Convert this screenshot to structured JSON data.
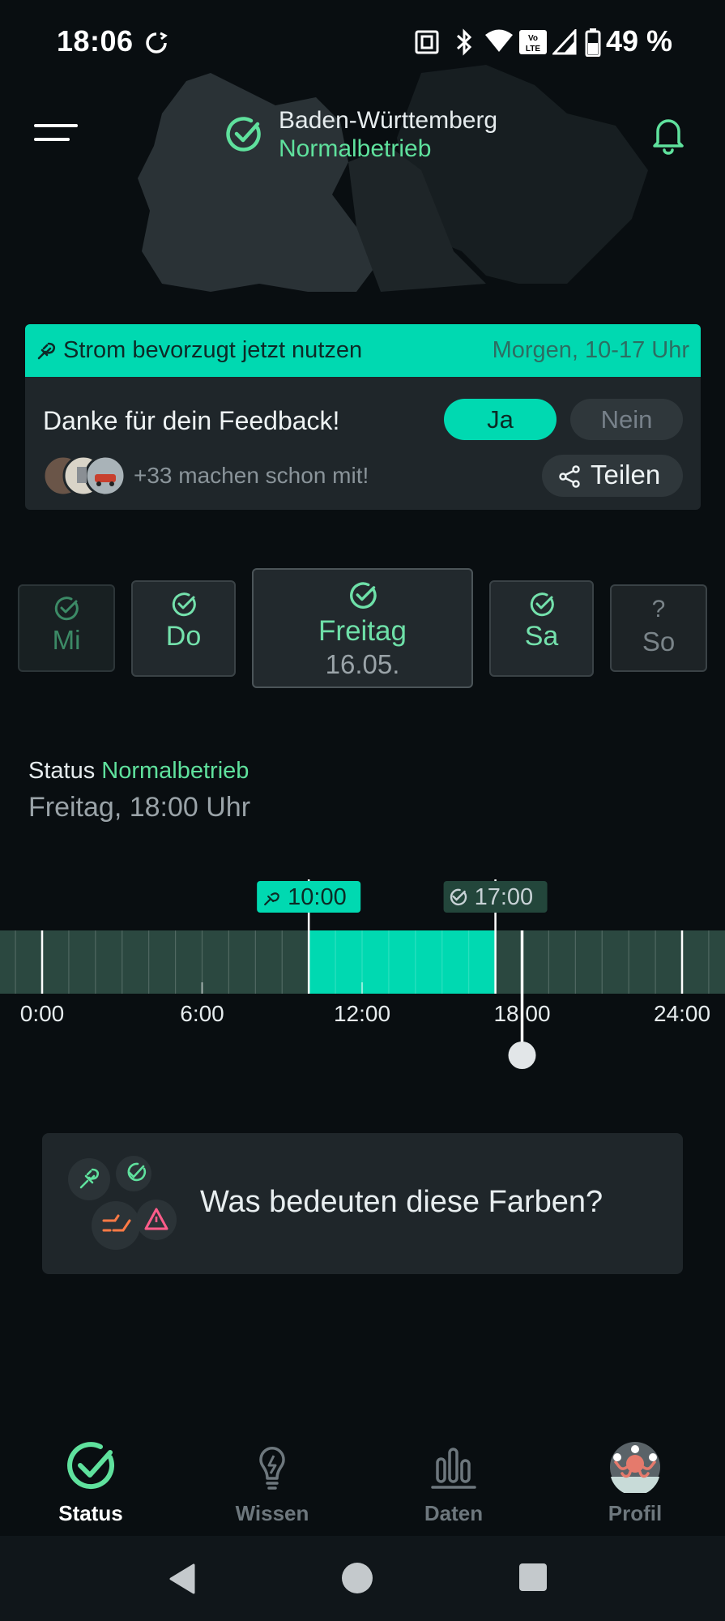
{
  "status_bar": {
    "time": "18:06",
    "battery": "49 %",
    "icons": [
      "sync-icon",
      "nfc-icon",
      "bluetooth-icon",
      "wifi-icon",
      "volte-icon",
      "signal-icon",
      "battery-icon"
    ]
  },
  "header": {
    "region": "Baden-Württemberg",
    "status": "Normalbetrieb",
    "icons": [
      "menu-icon",
      "check-circle-icon",
      "bell-icon"
    ]
  },
  "recommendation": {
    "title": "Strom bevorzugt jetzt nutzen",
    "time": "Morgen, 10-17 Uhr",
    "feedback": "Danke für dein Feedback!",
    "yes_label": "Ja",
    "no_label": "Nein",
    "selected": "Ja",
    "participants": "+33 machen schon mit!",
    "share_label": "Teilen"
  },
  "days": {
    "mi": {
      "label": "Mi"
    },
    "do": {
      "label": "Do"
    },
    "fr": {
      "label": "Freitag",
      "date": "16.05."
    },
    "sa": {
      "label": "Sa"
    },
    "so": {
      "label": "So",
      "marker": "?"
    },
    "selected": "fr"
  },
  "status_section": {
    "label": "Status",
    "value": "Normalbetrieb",
    "datetime": "Freitag, 18:00 Uhr"
  },
  "timeline": {
    "start_tag": "10:00",
    "end_tag": "17:00",
    "highlight_start_hour": 10,
    "highlight_end_hour": 17,
    "current_hour": 18,
    "ticks": [
      "0:00",
      "6:00",
      "12:00",
      "18:00",
      "24:00"
    ],
    "colors": {
      "normal": "#2b4840",
      "highlight": "#00d9b1"
    }
  },
  "colors_card": {
    "text": "Was bedeuten diese Farben?"
  },
  "bottom_nav": {
    "status": "Status",
    "wissen": "Wissen",
    "daten": "Daten",
    "profil": "Profil",
    "active": "status"
  },
  "theme": {
    "accent": "#00d9b1",
    "green": "#5fe19d",
    "background": "#090e11",
    "card": "#1f262a"
  }
}
